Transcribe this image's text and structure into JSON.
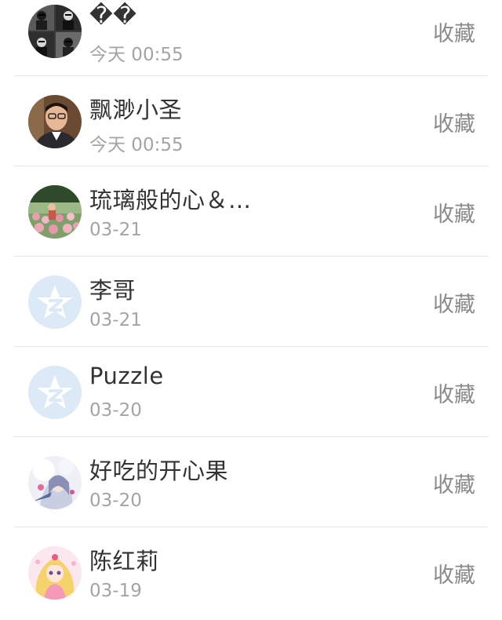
{
  "contacts": [
    {
      "name": "��",
      "time": "今天 00:55",
      "action": "收藏",
      "avatar": "photo-grid-avatar"
    },
    {
      "name": "飘渺小圣",
      "time": "今天 00:55",
      "action": "收藏",
      "avatar": "man-photo-avatar"
    },
    {
      "name": "琉璃般的心＆…",
      "time": "03-21",
      "action": "收藏",
      "avatar": "tulips-photo-avatar"
    },
    {
      "name": "李哥",
      "time": "03-21",
      "action": "收藏",
      "avatar": "qzone-star-avatar"
    },
    {
      "name": "Puzzle",
      "time": "03-20",
      "action": "收藏",
      "avatar": "qzone-star-avatar"
    },
    {
      "name": "好吃的开心果",
      "time": "03-20",
      "action": "收藏",
      "avatar": "anime-girl-avatar"
    },
    {
      "name": "陈红莉",
      "time": "03-19",
      "action": "收藏",
      "avatar": "anime-princess-avatar"
    }
  ],
  "colors": {
    "name_text": "#333333",
    "time_text": "#a4a4a4",
    "action_text": "#8a8a8a",
    "divider": "#e5e5e5",
    "default_avatar_bg": "#dce9f6"
  }
}
